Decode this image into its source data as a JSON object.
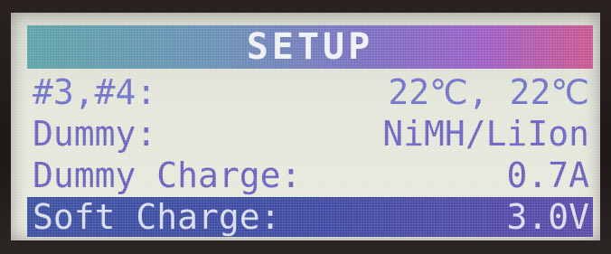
{
  "screen": {
    "title": "SETUP",
    "rows": [
      {
        "label": "#3,#4:",
        "value": "22℃,   22℃"
      },
      {
        "label": "Dummy:",
        "value": "NiMH/LiIon"
      },
      {
        "label": "Dummy Charge:",
        "value": "0.7A"
      },
      {
        "label": "Soft Charge:",
        "value": "3.0V",
        "selected": true
      }
    ]
  },
  "colors": {
    "lcd_background": "#e4e6da",
    "text": "#6a5fc4",
    "selected_row": "#3e4aa2",
    "selected_text": "#d8dcef"
  }
}
